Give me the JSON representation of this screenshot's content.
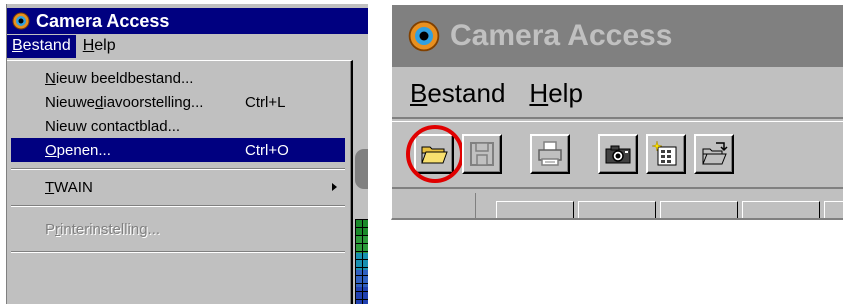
{
  "window": {
    "title": "Camera Access"
  },
  "menubar": {
    "items": [
      {
        "label": "Bestand",
        "mnemonic": "B",
        "rest": "estand"
      },
      {
        "label": "Help",
        "mnemonic": "H",
        "rest": "elp"
      }
    ]
  },
  "dropdown": {
    "items": [
      {
        "pre": "",
        "mn": "N",
        "post": "ieuw beeldbestand...",
        "shortcut": ""
      },
      {
        "pre": "Nieuwe ",
        "mn": "d",
        "post": "iavoorstelling...",
        "shortcut": "Ctrl+L"
      },
      {
        "pre": "Nieuw contactblad...",
        "mn": "",
        "post": "",
        "shortcut": ""
      },
      {
        "pre": "",
        "mn": "O",
        "post": "penen...",
        "shortcut": "Ctrl+O"
      },
      {
        "pre": "",
        "mn": "T",
        "post": "WAIN",
        "shortcut": ""
      },
      {
        "pre": "P",
        "mn": "r",
        "post": "interinstelling...",
        "shortcut": ""
      }
    ],
    "highlighted_index": 3,
    "disabled_index": 5
  },
  "toolbar": {
    "buttons": [
      "open-folder",
      "save-disk",
      "print",
      "camera",
      "new-contact-sheet",
      "open-file"
    ],
    "highlighted_button": "open-folder",
    "highlight_color": "#e00000"
  },
  "colors": {
    "title_active": "#000080",
    "title_inactive": "#808080",
    "face": "#c0c0c0"
  }
}
